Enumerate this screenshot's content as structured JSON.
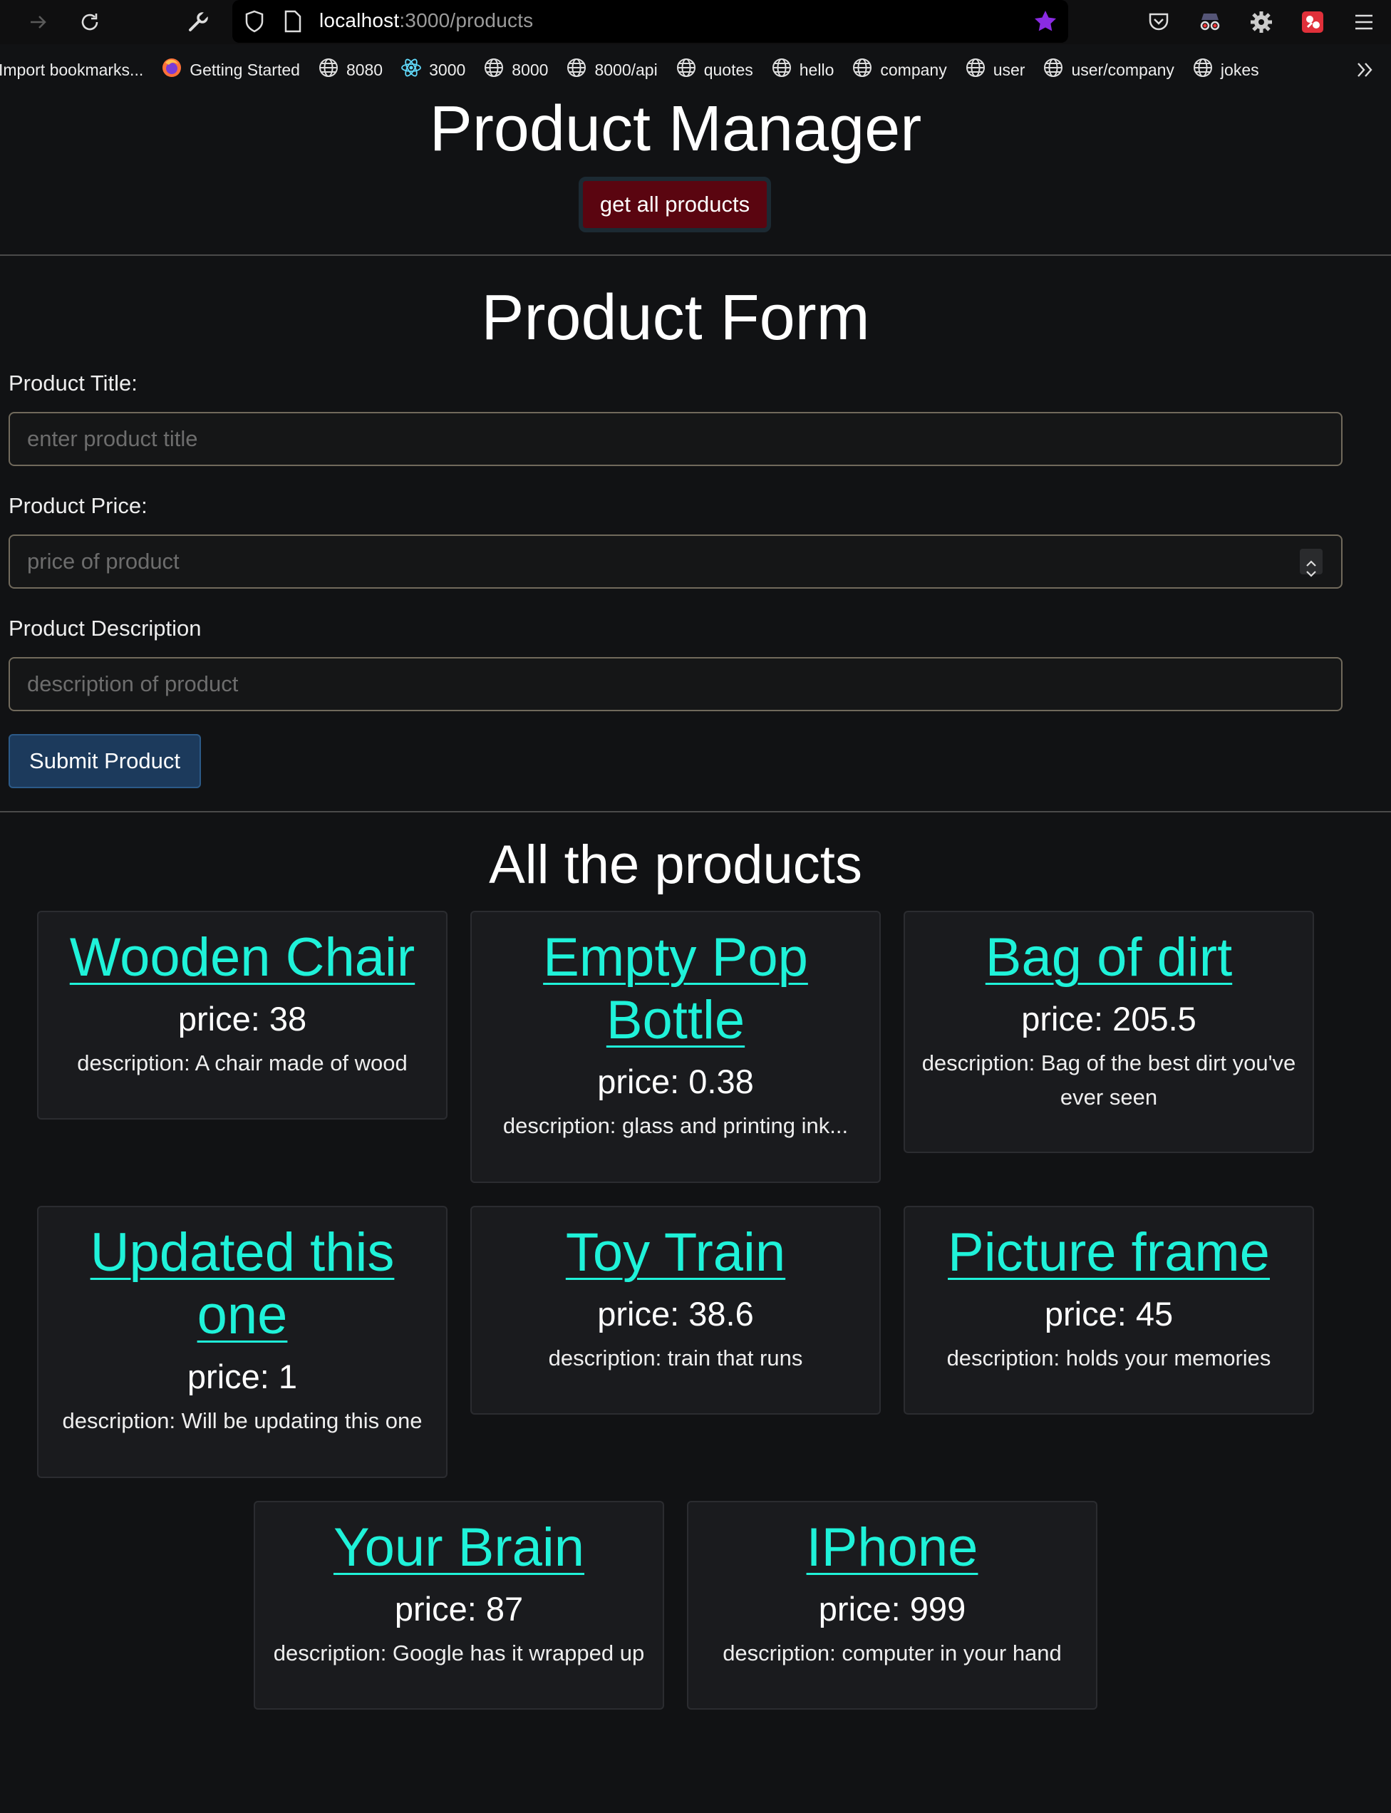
{
  "browser": {
    "url_host": "localhost",
    "url_path": ":3000/products",
    "bookmarks": [
      {
        "label": "Import bookmarks...",
        "icon": "none"
      },
      {
        "label": "Getting Started",
        "icon": "firefox-icon"
      },
      {
        "label": "8080",
        "icon": "globe-icon"
      },
      {
        "label": "3000",
        "icon": "react-icon"
      },
      {
        "label": "8000",
        "icon": "globe-icon"
      },
      {
        "label": "8000/api",
        "icon": "globe-icon"
      },
      {
        "label": "quotes",
        "icon": "globe-icon"
      },
      {
        "label": "hello",
        "icon": "globe-icon"
      },
      {
        "label": "company",
        "icon": "globe-icon"
      },
      {
        "label": "user",
        "icon": "globe-icon"
      },
      {
        "label": "user/company",
        "icon": "globe-icon"
      },
      {
        "label": "jokes",
        "icon": "globe-icon"
      }
    ]
  },
  "header": {
    "title": "Product Manager",
    "get_all_label": "get all products"
  },
  "form": {
    "title": "Product Form",
    "title_label": "Product Title:",
    "title_placeholder": "enter product title",
    "price_label": "Product Price:",
    "price_placeholder": "price of product",
    "description_label": "Product Description",
    "description_placeholder": "description of product",
    "submit_label": "Submit Product"
  },
  "products": {
    "title": "All the products",
    "items": [
      {
        "name": "Wooden Chair",
        "price": "price: 38",
        "description": "description: A chair made of wood"
      },
      {
        "name": "Empty Pop Bottle",
        "price": "price: 0.38",
        "description": "description: glass and printing ink..."
      },
      {
        "name": "Bag of dirt",
        "price": "price: 205.5",
        "description": "description: Bag of the best dirt you've ever seen"
      },
      {
        "name": "Updated this one",
        "price": "price: 1",
        "description": "description: Will be updating this one"
      },
      {
        "name": "Toy Train",
        "price": "price: 38.6",
        "description": "description: train that runs"
      },
      {
        "name": "Picture frame",
        "price": "price: 45",
        "description": "description: holds your memories"
      },
      {
        "name": "Your Brain",
        "price": "price: 87",
        "description": "description: Google has it wrapped up"
      },
      {
        "name": "IPhone",
        "price": "price: 999",
        "description": "description: computer in your hand"
      }
    ]
  },
  "colors": {
    "background": "#111214",
    "link": "#1ff2d9",
    "get_all_button": "#5a0510",
    "submit_button": "#1c3a5c",
    "card": "#1a1b1e",
    "bookmark_star": "#8a2be2"
  }
}
